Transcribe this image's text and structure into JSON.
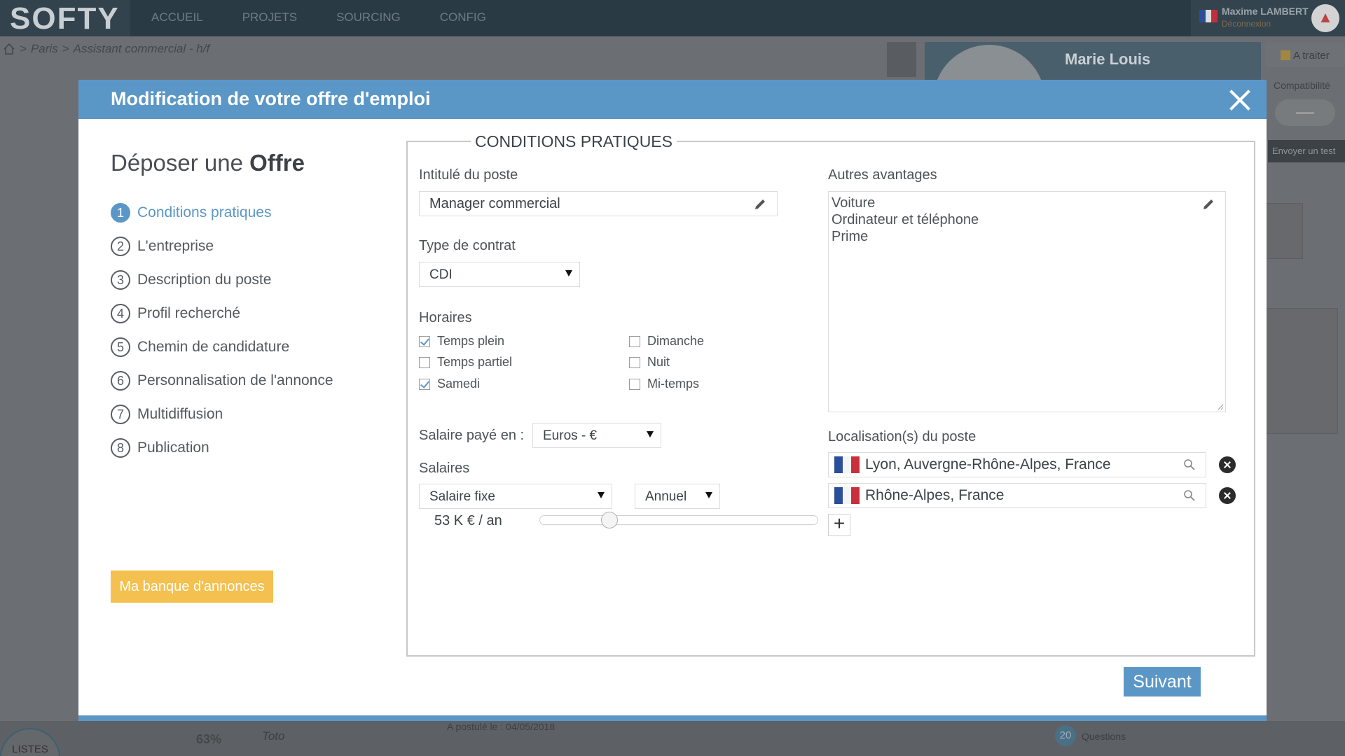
{
  "app": {
    "logo": "SOFTY",
    "nav": [
      "ACCUEIL",
      "PROJETS",
      "SOURCING",
      "CONFIG"
    ],
    "user": {
      "name": "Maxime LAMBERT",
      "sub": "Déconnexion"
    }
  },
  "breadcrumb": {
    "city": "Paris",
    "job": "Assistant commercial - h/f"
  },
  "background": {
    "candidate_name": "Marie Louis",
    "status": "A traiter",
    "compat_label": "Compatibilité",
    "send_test": "Envoyer un test",
    "listes": "LISTES",
    "postule": "A postulé le : 04/05/2018",
    "toto": "Toto",
    "pct": "63%",
    "questions_count": "20",
    "questions": "Questions"
  },
  "modal": {
    "title": "Modification de votre offre d'emploi",
    "heading_prefix": "Déposer une",
    "heading_bold": "Offre",
    "steps": [
      {
        "num": "1",
        "label": "Conditions pratiques"
      },
      {
        "num": "2",
        "label": "L'entreprise"
      },
      {
        "num": "3",
        "label": "Description du poste"
      },
      {
        "num": "4",
        "label": "Profil recherché"
      },
      {
        "num": "5",
        "label": "Chemin de candidature"
      },
      {
        "num": "6",
        "label": "Personnalisation de l'annonce"
      },
      {
        "num": "7",
        "label": "Multidiffusion"
      },
      {
        "num": "8",
        "label": "Publication"
      }
    ],
    "bank_button": "Ma banque d'annonces",
    "next_button": "Suivant"
  },
  "form": {
    "legend": "CONDITIONS PRATIQUES",
    "job_title_label": "Intitulé du poste",
    "job_title_value": "Manager commercial",
    "contract_label": "Type de contrat",
    "contract_value": "CDI",
    "hours_label": "Horaires",
    "hours": [
      {
        "label": "Temps plein",
        "checked": true
      },
      {
        "label": "Temps partiel",
        "checked": false
      },
      {
        "label": "Samedi",
        "checked": true
      },
      {
        "label": "Dimanche",
        "checked": false
      },
      {
        "label": "Nuit",
        "checked": false
      },
      {
        "label": "Mi-temps",
        "checked": false
      }
    ],
    "currency_label": "Salaire payé en :",
    "currency_value": "Euros - €",
    "salary_label": "Salaires",
    "salary_type": "Salaire fixe",
    "salary_period": "Annuel",
    "salary_display": "53 K € / an",
    "salary_slider_fraction": 0.25,
    "benefits_label": "Autres avantages",
    "benefits": [
      "Voiture",
      "Ordinateur et téléphone",
      "Prime"
    ],
    "locations_label": "Localisation(s) du poste",
    "locations": [
      "Lyon, Auvergne-Rhône-Alpes, France",
      "Rhône-Alpes, France"
    ]
  },
  "colors": {
    "accent": "#5b97c6",
    "bank_button": "#f4c04f"
  }
}
